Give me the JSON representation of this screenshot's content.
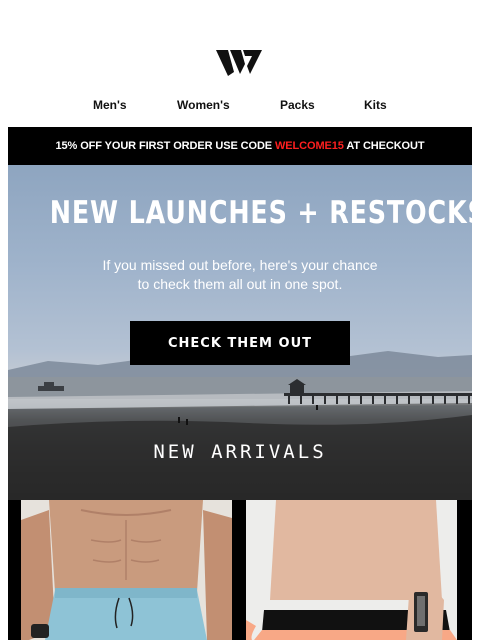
{
  "brand": {
    "logo_icon": "brand-logo-icon"
  },
  "nav": {
    "items": [
      "Men's",
      "Women's",
      "Packs",
      "Kits"
    ]
  },
  "promo": {
    "before": "15% OFF YOUR FIRST ORDER USE CODE ",
    "code": "WELCOME15",
    "after": " AT CHECKOUT",
    "code_color": "#ff1f1f"
  },
  "hero": {
    "title": "NEW LAUNCHES + RESTOCKS",
    "subtitle_line1": "If you missed out before, here's your chance",
    "subtitle_line2": "to check them all out in one spot.",
    "cta_label": "CHECK THEM OUT",
    "section_title": "NEW ARRIVALS"
  },
  "products": [
    {
      "image": "mens-blue-shorts-photo",
      "color": "#8ec3d6"
    },
    {
      "image": "womens-peach-shorts-photo",
      "color": "#f8a886"
    }
  ],
  "colors": {
    "accent": "#ff1f1f",
    "black": "#000000",
    "white": "#ffffff"
  }
}
